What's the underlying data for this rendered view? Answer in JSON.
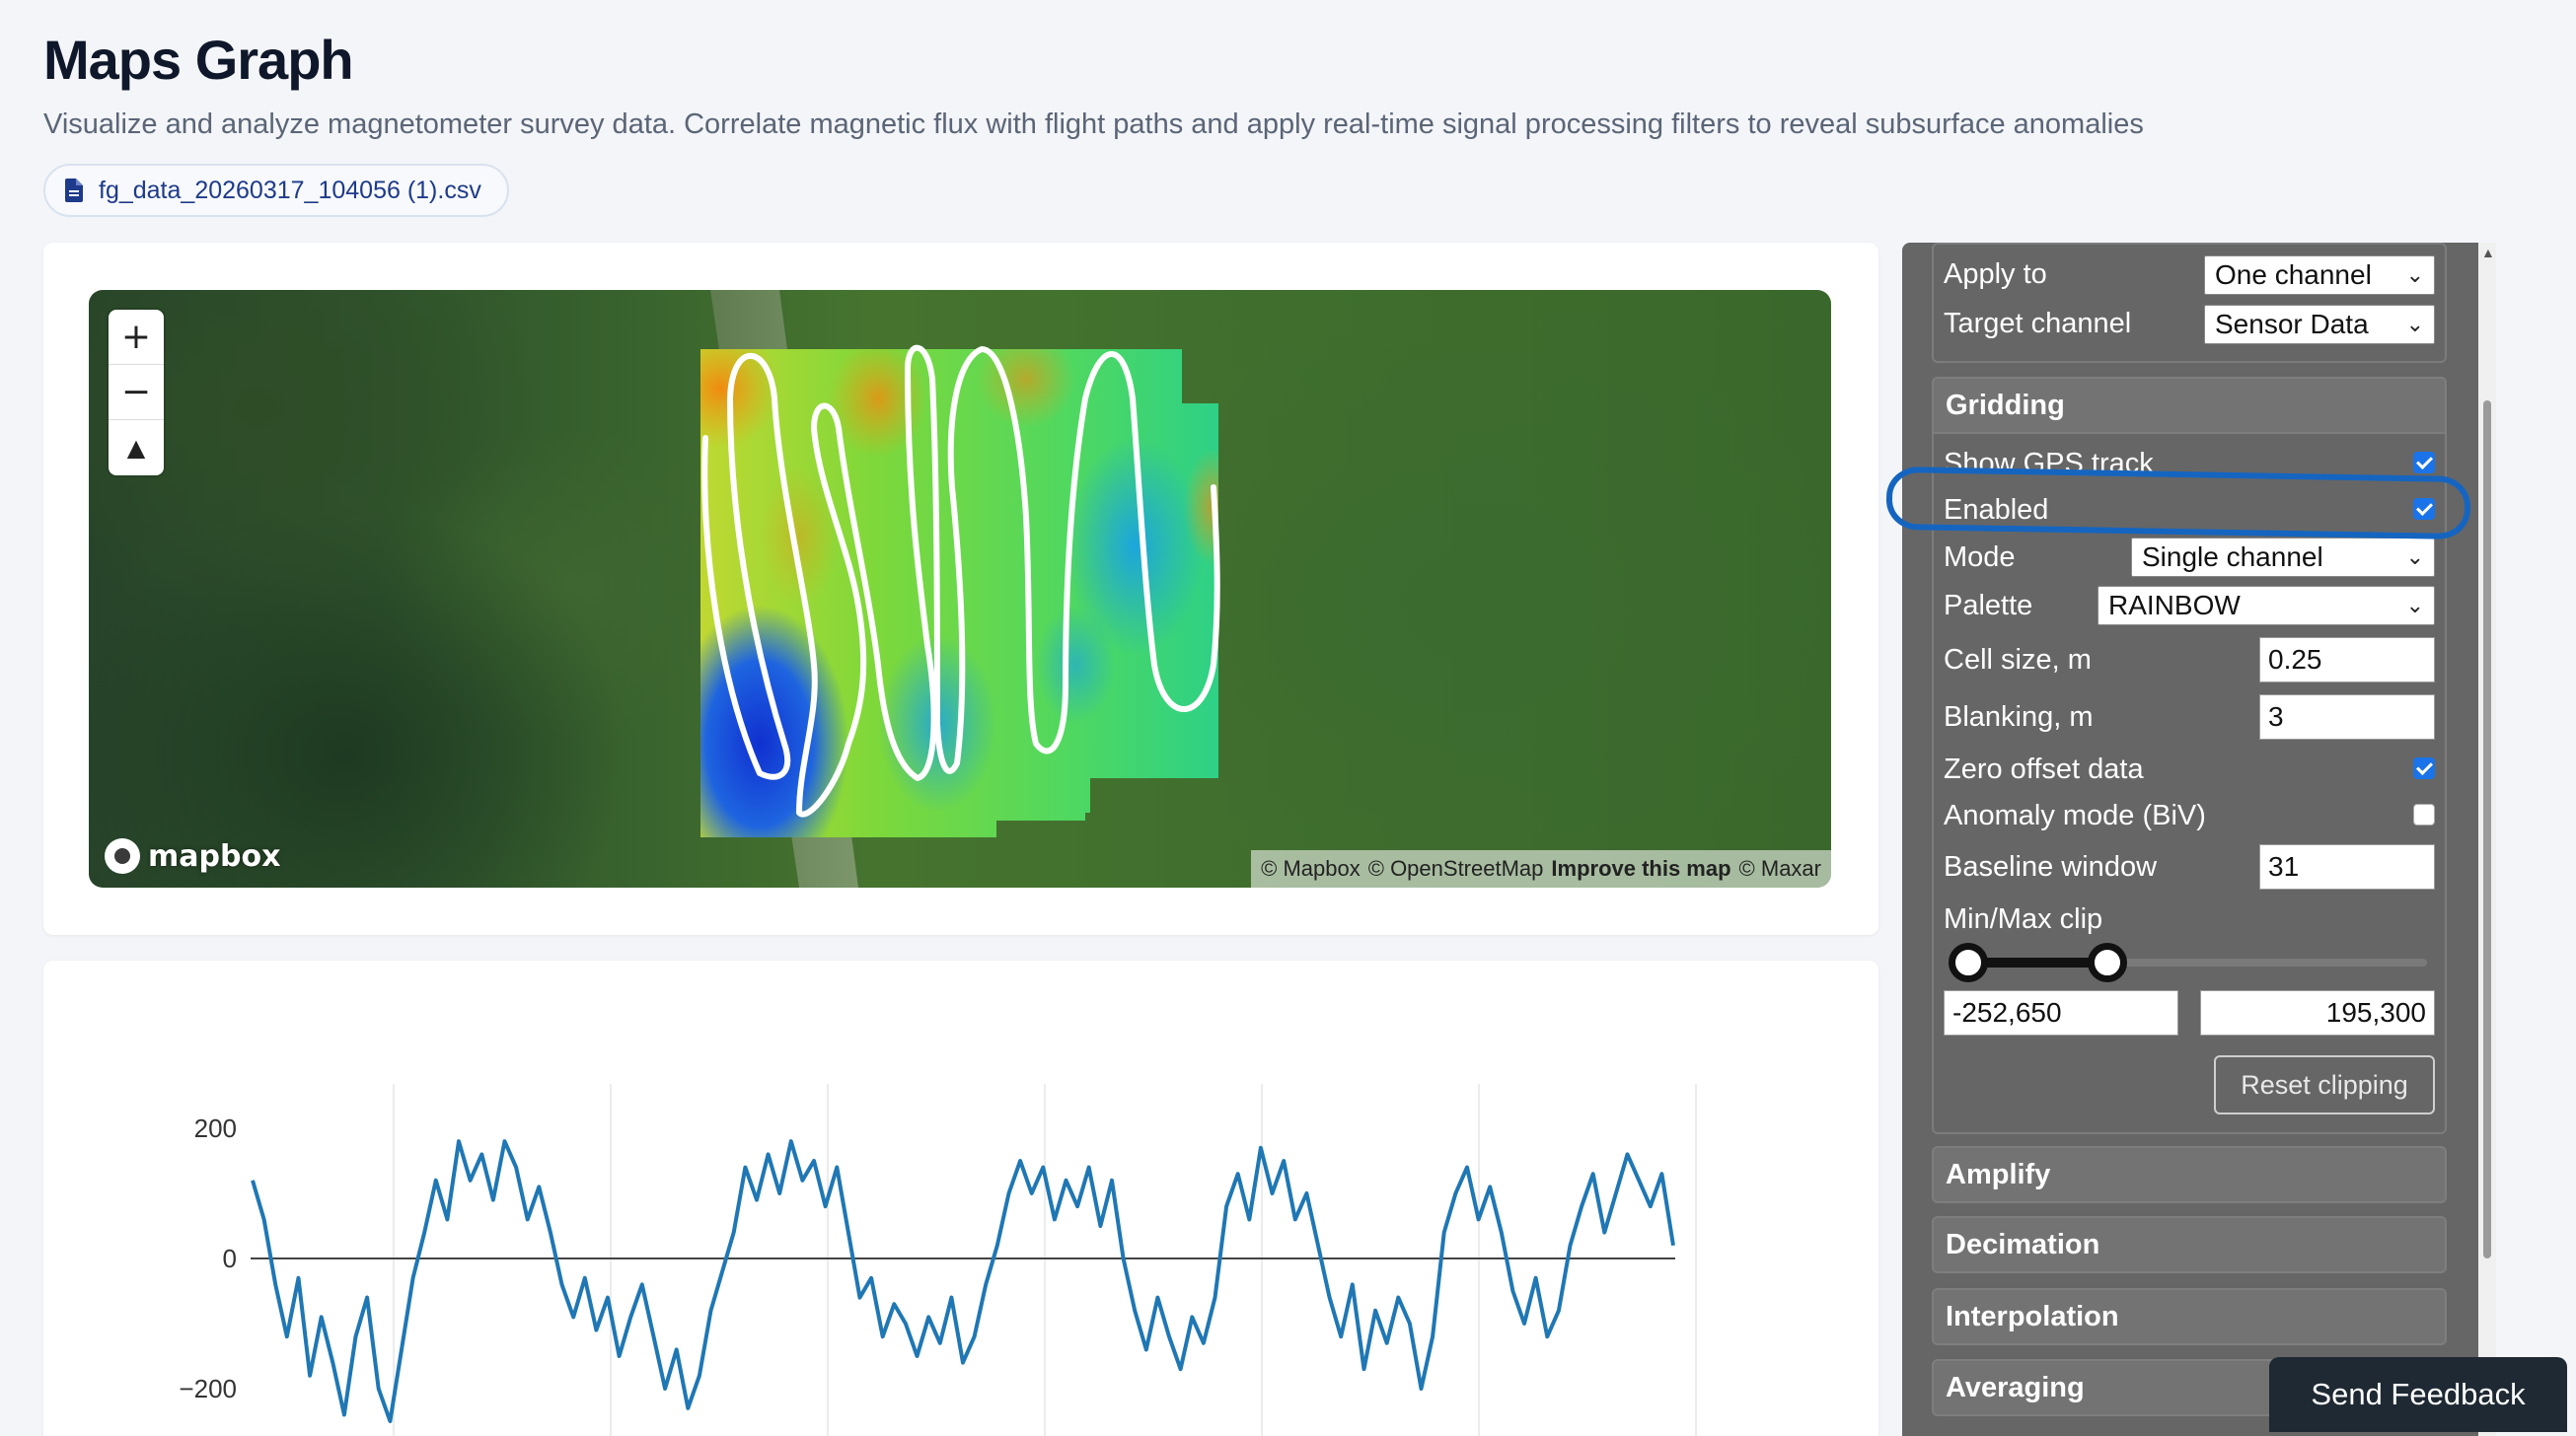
{
  "header": {
    "title": "Maps Graph",
    "subtitle": "Visualize and analyze magnetometer survey data. Correlate magnetic flux with flight paths and apply real-time signal processing filters to reveal subsurface anomalies",
    "file_name": "fg_data_20260317_104056 (1).csv",
    "file_icon": "file-icon"
  },
  "map": {
    "zoom_in": "+",
    "zoom_out": "−",
    "compass": "▲",
    "logo_text": "mapbox",
    "attribution": {
      "mapbox": "© Mapbox",
      "osm": "© OpenStreetMap",
      "improve": "Improve this map",
      "maxar": "© Maxar"
    }
  },
  "panel": {
    "apply_to": {
      "label": "Apply to",
      "value": "One channel"
    },
    "target_channel": {
      "label": "Target channel",
      "value": "Sensor Data"
    },
    "gridding": {
      "title": "Gridding",
      "show_gps_track": {
        "label": "Show GPS track",
        "checked": true
      },
      "enabled": {
        "label": "Enabled",
        "checked": true
      },
      "mode": {
        "label": "Mode",
        "value": "Single channel"
      },
      "palette": {
        "label": "Palette",
        "value": "RAINBOW"
      },
      "cell_size": {
        "label": "Cell size, m",
        "value": "0.25"
      },
      "blanking": {
        "label": "Blanking, m",
        "value": "3"
      },
      "zero_offset": {
        "label": "Zero offset data",
        "checked": true
      },
      "anomaly_mode": {
        "label": "Anomaly mode (BiV)",
        "checked": false
      },
      "baseline_window": {
        "label": "Baseline window",
        "value": "31"
      },
      "clip": {
        "label": "Min/Max clip",
        "min": "-252,650",
        "max": "195,300"
      },
      "reset_label": "Reset clipping"
    },
    "sections": [
      "Amplify",
      "Decimation",
      "Interpolation",
      "Averaging"
    ]
  },
  "chart_data": {
    "type": "line",
    "title": "",
    "xlabel": "",
    "ylabel": "",
    "ylim": [
      -250,
      205
    ],
    "y_ticks": [
      "200",
      "0",
      "−200"
    ],
    "y_tick_values": [
      200,
      0,
      -200
    ],
    "series": [
      {
        "color": "#1f77b4",
        "y": [
          120,
          60,
          -40,
          -120,
          -30,
          -180,
          -90,
          -160,
          -240,
          -120,
          -60,
          -200,
          -250,
          -140,
          -30,
          40,
          120,
          60,
          180,
          120,
          160,
          90,
          180,
          140,
          60,
          110,
          40,
          -40,
          -90,
          -30,
          -110,
          -60,
          -150,
          -90,
          -40,
          -120,
          -200,
          -140,
          -230,
          -180,
          -80,
          -20,
          40,
          140,
          90,
          160,
          100,
          180,
          120,
          150,
          80,
          140,
          40,
          -60,
          -30,
          -120,
          -70,
          -100,
          -150,
          -90,
          -130,
          -60,
          -160,
          -120,
          -40,
          20,
          100,
          150,
          100,
          140,
          60,
          120,
          80,
          140,
          50,
          120,
          0,
          -80,
          -140,
          -60,
          -120,
          -170,
          -90,
          -130,
          -60,
          80,
          130,
          60,
          170,
          100,
          150,
          60,
          100,
          20,
          -60,
          -120,
          -40,
          -170,
          -80,
          -130,
          -60,
          -100,
          -200,
          -120,
          40,
          100,
          140,
          60,
          110,
          40,
          -50,
          -100,
          -30,
          -120,
          -80,
          20,
          80,
          130,
          40,
          100,
          160,
          120,
          80,
          130,
          20
        ]
      }
    ]
  },
  "feedback_label": "Send Feedback"
}
